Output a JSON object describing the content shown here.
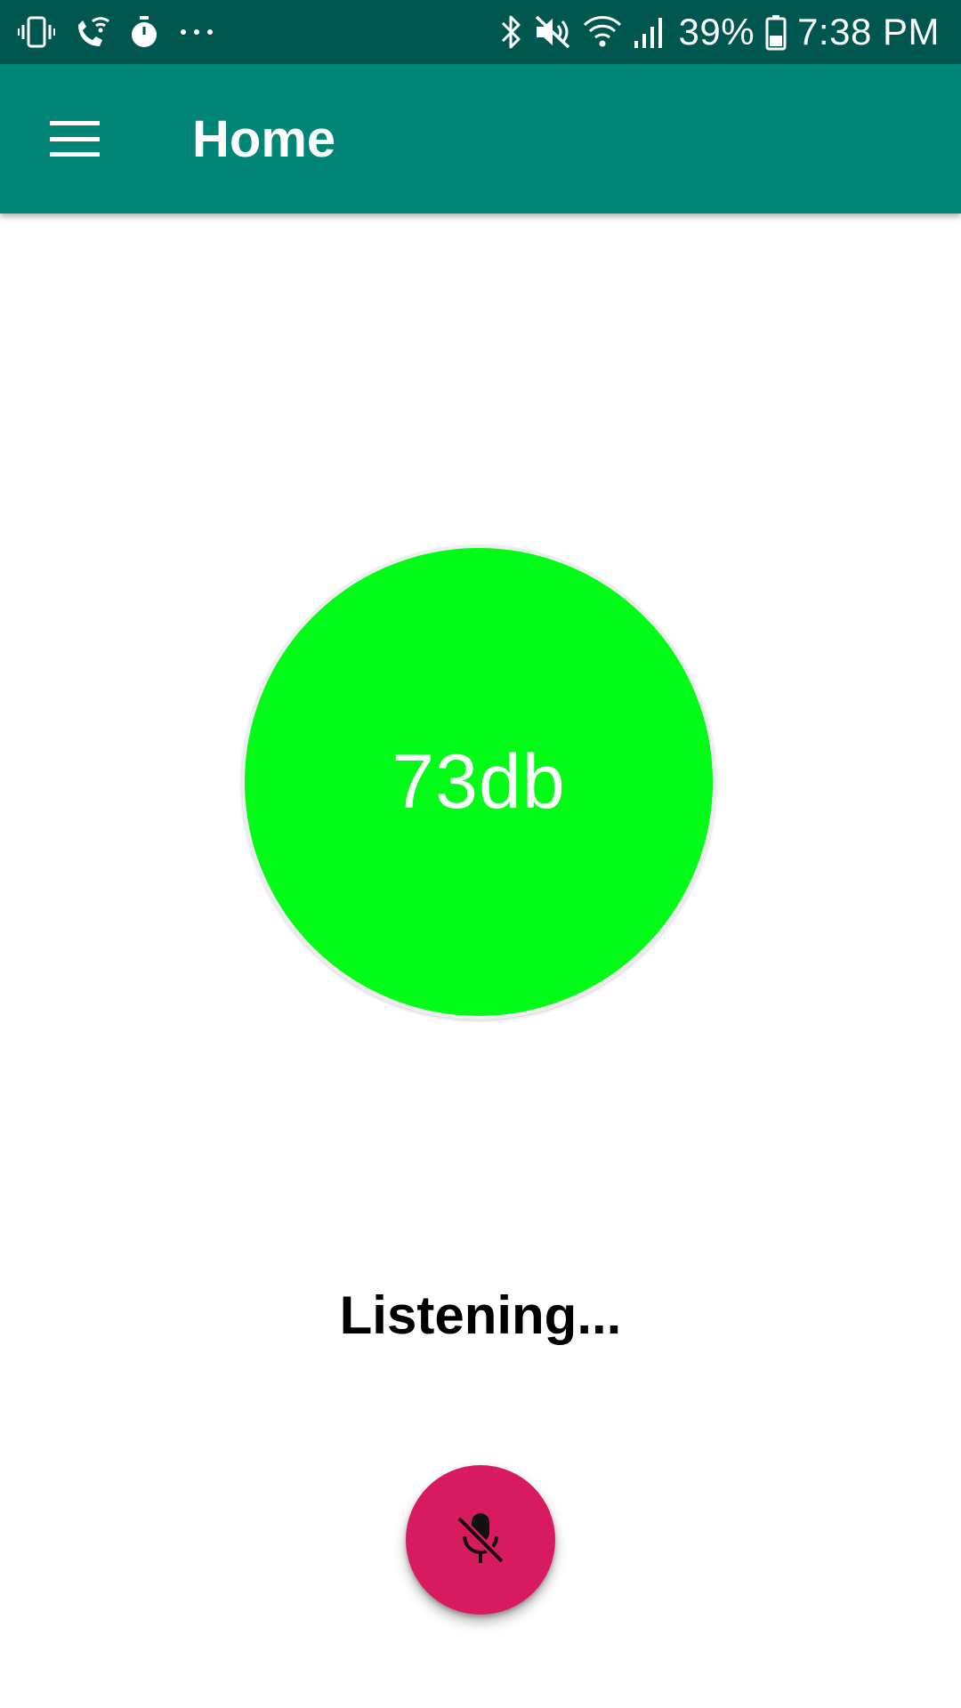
{
  "status_bar": {
    "icons_left": [
      "vibrate-icon",
      "wifi-calling-icon",
      "stopwatch-icon",
      "more-notifications-icon"
    ],
    "icons_right": [
      "bluetooth-icon",
      "mute-icon",
      "wifi-icon",
      "signal-icon",
      "battery-icon"
    ],
    "battery_percent": "39%",
    "time": "7:38 PM"
  },
  "app_bar": {
    "menu_icon": "menu-icon",
    "title": "Home"
  },
  "meter": {
    "level_text": "73db",
    "color": "#03fc17"
  },
  "status_label": "Listening...",
  "fab": {
    "icon": "mic-off-icon",
    "color": "#d81b60"
  },
  "colors": {
    "status_bar": "#00574f",
    "app_bar": "#018577"
  }
}
